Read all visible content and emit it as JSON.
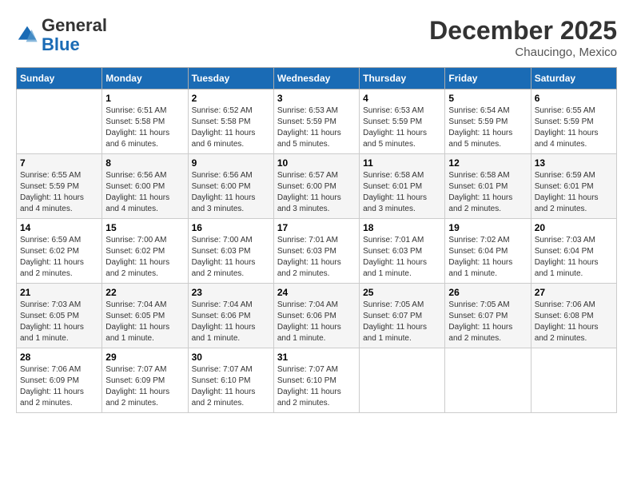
{
  "header": {
    "logo_line1": "General",
    "logo_line2": "Blue",
    "month": "December 2025",
    "location": "Chaucingo, Mexico"
  },
  "days_of_week": [
    "Sunday",
    "Monday",
    "Tuesday",
    "Wednesday",
    "Thursday",
    "Friday",
    "Saturday"
  ],
  "weeks": [
    [
      {
        "num": "",
        "info": ""
      },
      {
        "num": "1",
        "info": "Sunrise: 6:51 AM\nSunset: 5:58 PM\nDaylight: 11 hours\nand 6 minutes."
      },
      {
        "num": "2",
        "info": "Sunrise: 6:52 AM\nSunset: 5:58 PM\nDaylight: 11 hours\nand 6 minutes."
      },
      {
        "num": "3",
        "info": "Sunrise: 6:53 AM\nSunset: 5:59 PM\nDaylight: 11 hours\nand 5 minutes."
      },
      {
        "num": "4",
        "info": "Sunrise: 6:53 AM\nSunset: 5:59 PM\nDaylight: 11 hours\nand 5 minutes."
      },
      {
        "num": "5",
        "info": "Sunrise: 6:54 AM\nSunset: 5:59 PM\nDaylight: 11 hours\nand 5 minutes."
      },
      {
        "num": "6",
        "info": "Sunrise: 6:55 AM\nSunset: 5:59 PM\nDaylight: 11 hours\nand 4 minutes."
      }
    ],
    [
      {
        "num": "7",
        "info": "Sunrise: 6:55 AM\nSunset: 5:59 PM\nDaylight: 11 hours\nand 4 minutes."
      },
      {
        "num": "8",
        "info": "Sunrise: 6:56 AM\nSunset: 6:00 PM\nDaylight: 11 hours\nand 4 minutes."
      },
      {
        "num": "9",
        "info": "Sunrise: 6:56 AM\nSunset: 6:00 PM\nDaylight: 11 hours\nand 3 minutes."
      },
      {
        "num": "10",
        "info": "Sunrise: 6:57 AM\nSunset: 6:00 PM\nDaylight: 11 hours\nand 3 minutes."
      },
      {
        "num": "11",
        "info": "Sunrise: 6:58 AM\nSunset: 6:01 PM\nDaylight: 11 hours\nand 3 minutes."
      },
      {
        "num": "12",
        "info": "Sunrise: 6:58 AM\nSunset: 6:01 PM\nDaylight: 11 hours\nand 2 minutes."
      },
      {
        "num": "13",
        "info": "Sunrise: 6:59 AM\nSunset: 6:01 PM\nDaylight: 11 hours\nand 2 minutes."
      }
    ],
    [
      {
        "num": "14",
        "info": "Sunrise: 6:59 AM\nSunset: 6:02 PM\nDaylight: 11 hours\nand 2 minutes."
      },
      {
        "num": "15",
        "info": "Sunrise: 7:00 AM\nSunset: 6:02 PM\nDaylight: 11 hours\nand 2 minutes."
      },
      {
        "num": "16",
        "info": "Sunrise: 7:00 AM\nSunset: 6:03 PM\nDaylight: 11 hours\nand 2 minutes."
      },
      {
        "num": "17",
        "info": "Sunrise: 7:01 AM\nSunset: 6:03 PM\nDaylight: 11 hours\nand 2 minutes."
      },
      {
        "num": "18",
        "info": "Sunrise: 7:01 AM\nSunset: 6:03 PM\nDaylight: 11 hours\nand 1 minute."
      },
      {
        "num": "19",
        "info": "Sunrise: 7:02 AM\nSunset: 6:04 PM\nDaylight: 11 hours\nand 1 minute."
      },
      {
        "num": "20",
        "info": "Sunrise: 7:03 AM\nSunset: 6:04 PM\nDaylight: 11 hours\nand 1 minute."
      }
    ],
    [
      {
        "num": "21",
        "info": "Sunrise: 7:03 AM\nSunset: 6:05 PM\nDaylight: 11 hours\nand 1 minute."
      },
      {
        "num": "22",
        "info": "Sunrise: 7:04 AM\nSunset: 6:05 PM\nDaylight: 11 hours\nand 1 minute."
      },
      {
        "num": "23",
        "info": "Sunrise: 7:04 AM\nSunset: 6:06 PM\nDaylight: 11 hours\nand 1 minute."
      },
      {
        "num": "24",
        "info": "Sunrise: 7:04 AM\nSunset: 6:06 PM\nDaylight: 11 hours\nand 1 minute."
      },
      {
        "num": "25",
        "info": "Sunrise: 7:05 AM\nSunset: 6:07 PM\nDaylight: 11 hours\nand 1 minute."
      },
      {
        "num": "26",
        "info": "Sunrise: 7:05 AM\nSunset: 6:07 PM\nDaylight: 11 hours\nand 2 minutes."
      },
      {
        "num": "27",
        "info": "Sunrise: 7:06 AM\nSunset: 6:08 PM\nDaylight: 11 hours\nand 2 minutes."
      }
    ],
    [
      {
        "num": "28",
        "info": "Sunrise: 7:06 AM\nSunset: 6:09 PM\nDaylight: 11 hours\nand 2 minutes."
      },
      {
        "num": "29",
        "info": "Sunrise: 7:07 AM\nSunset: 6:09 PM\nDaylight: 11 hours\nand 2 minutes."
      },
      {
        "num": "30",
        "info": "Sunrise: 7:07 AM\nSunset: 6:10 PM\nDaylight: 11 hours\nand 2 minutes."
      },
      {
        "num": "31",
        "info": "Sunrise: 7:07 AM\nSunset: 6:10 PM\nDaylight: 11 hours\nand 2 minutes."
      },
      {
        "num": "",
        "info": ""
      },
      {
        "num": "",
        "info": ""
      },
      {
        "num": "",
        "info": ""
      }
    ]
  ]
}
